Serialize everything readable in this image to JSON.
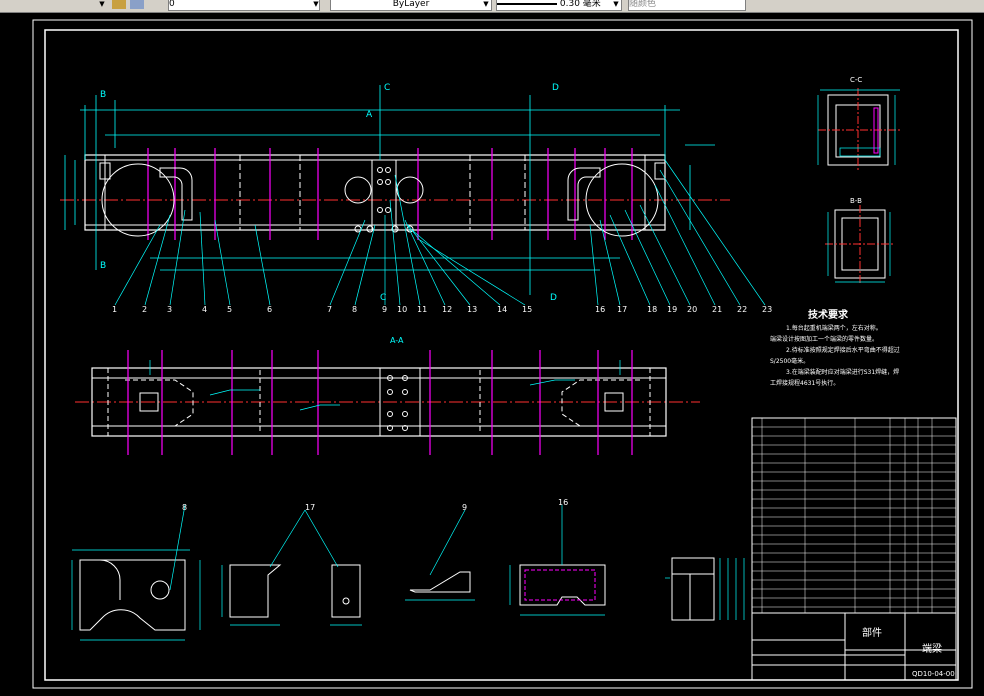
{
  "toolbar": {
    "layer_value": "0",
    "color_value": "ByLayer",
    "lineweight_value": "0.30 毫米",
    "plotstyle_value": "随颜色"
  },
  "drawing": {
    "tech_req": {
      "title": "技术要求",
      "lines": [
        "1.每台起重机端梁两个，左右对称。",
        "端梁设计按图加工一个端梁的零件数量。",
        "2.待标准按照规定焊接后水平弯曲不得超过",
        "S/2500毫米。",
        "3.在端梁装配时应对端梁进行S31焊缝，焊",
        "工焊接规程4631号执行。"
      ]
    },
    "title_block": {
      "part_type": "部件",
      "part_name": "端梁",
      "drawing_no": "QD10-04-00"
    },
    "balloons": [
      "1",
      "2",
      "3",
      "4",
      "5",
      "6",
      "7",
      "8",
      "9",
      "10",
      "11",
      "12",
      "13",
      "14",
      "15",
      "16",
      "17",
      "18",
      "19",
      "20",
      "21",
      "22",
      "23"
    ],
    "detail_labels": [
      "8",
      "17",
      "9",
      "16"
    ],
    "section_labels": {
      "a": "A-A",
      "b": "B-B",
      "c": "C-C"
    }
  }
}
